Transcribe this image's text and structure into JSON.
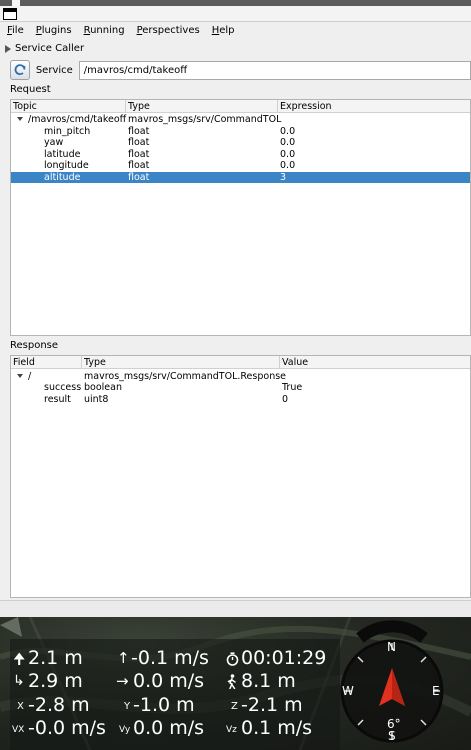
{
  "menu": {
    "items": [
      {
        "accel": "F",
        "rest": "ile"
      },
      {
        "accel": "P",
        "rest": "lugins"
      },
      {
        "accel": "R",
        "rest": "unning"
      },
      {
        "accel": "P",
        "rest": "erspectives"
      },
      {
        "accel": "H",
        "rest": "elp"
      }
    ]
  },
  "plugin": {
    "title": "Service Caller"
  },
  "service": {
    "label": "Service",
    "value": "/mavros/cmd/takeoff"
  },
  "request": {
    "label": "Request",
    "columns": [
      "Topic",
      "Type",
      "Expression"
    ],
    "root": {
      "topic": "/mavros/cmd/takeoff",
      "type": "mavros_msgs/srv/CommandTOL",
      "expression": ""
    },
    "rows": [
      {
        "topic": "min_pitch",
        "type": "float",
        "expression": "0.0"
      },
      {
        "topic": "yaw",
        "type": "float",
        "expression": "0.0"
      },
      {
        "topic": "latitude",
        "type": "float",
        "expression": "0.0"
      },
      {
        "topic": "longitude",
        "type": "float",
        "expression": "0.0"
      },
      {
        "topic": "altitude",
        "type": "float",
        "expression": "3"
      }
    ]
  },
  "response": {
    "label": "Response",
    "columns": [
      "Field",
      "Type",
      "Value"
    ],
    "root": {
      "field": "/",
      "type": "mavros_msgs/srv/CommandTOL.Response",
      "value": ""
    },
    "rows": [
      {
        "field": "success",
        "type": "boolean",
        "value": "True"
      },
      {
        "field": "result",
        "type": "uint8",
        "value": "0"
      }
    ]
  },
  "telemetry": {
    "altitude": "2.1 m",
    "distance": "2.9 m",
    "x": "-2.8 m",
    "vertical_speed": "-0.1 m/s",
    "horizontal_speed": "0.0 m/s",
    "y": "-1.0 m",
    "flight_time": "00:01:29",
    "home_distance": "8.1 m",
    "z": "-2.1 m",
    "vx": "-0.0 m/s",
    "vy": "0.0 m/s",
    "vz": "0.1 m/s",
    "x_label": "X",
    "y_label": "Y",
    "z_label": "Z",
    "vx_label": "VX",
    "vy_label": "Vy",
    "vz_label": "Vz"
  },
  "compass": {
    "n": "N",
    "e": "E",
    "s": "S",
    "w": "W",
    "heading_label": "6°"
  },
  "colors": {
    "accent": "#3b84c6",
    "compass_arrow": "#e4301f"
  }
}
